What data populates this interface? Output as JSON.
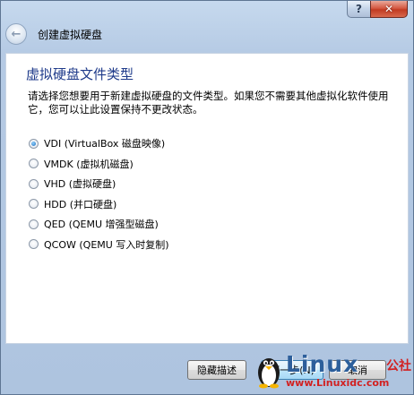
{
  "window": {
    "help_label": "?",
    "close_label": "✕"
  },
  "header": {
    "back_icon": "back-arrow-icon",
    "title": "创建虚拟硬盘"
  },
  "content": {
    "page_title": "虚拟硬盘文件类型",
    "description": "请选择您想要用于新建虚拟硬盘的文件类型。如果您不需要其他虚拟化软件使用它，您可以让此设置保持不更改状态。",
    "options": [
      {
        "label": "VDI (VirtualBox 磁盘映像)",
        "checked": true
      },
      {
        "label": "VMDK (虚拟机磁盘)",
        "checked": false
      },
      {
        "label": "VHD (虚拟硬盘)",
        "checked": false
      },
      {
        "label": "HDD (并口硬盘)",
        "checked": false
      },
      {
        "label": "QED (QEMU 增强型磁盘)",
        "checked": false
      },
      {
        "label": "QCOW (QEMU 写入时复制)",
        "checked": false
      }
    ]
  },
  "footer": {
    "hide_description_label": "隐藏描述",
    "next_label": "下一步(N)",
    "cancel_label": "取消"
  },
  "watermark": {
    "logo_text": "Linux",
    "suffix_text": "公社",
    "url_text": "www.Linuxidc.com"
  },
  "colors": {
    "title_blue": "#1e3a8a",
    "accent_red": "#d22020",
    "logo_blue": "#2d5f9b"
  }
}
